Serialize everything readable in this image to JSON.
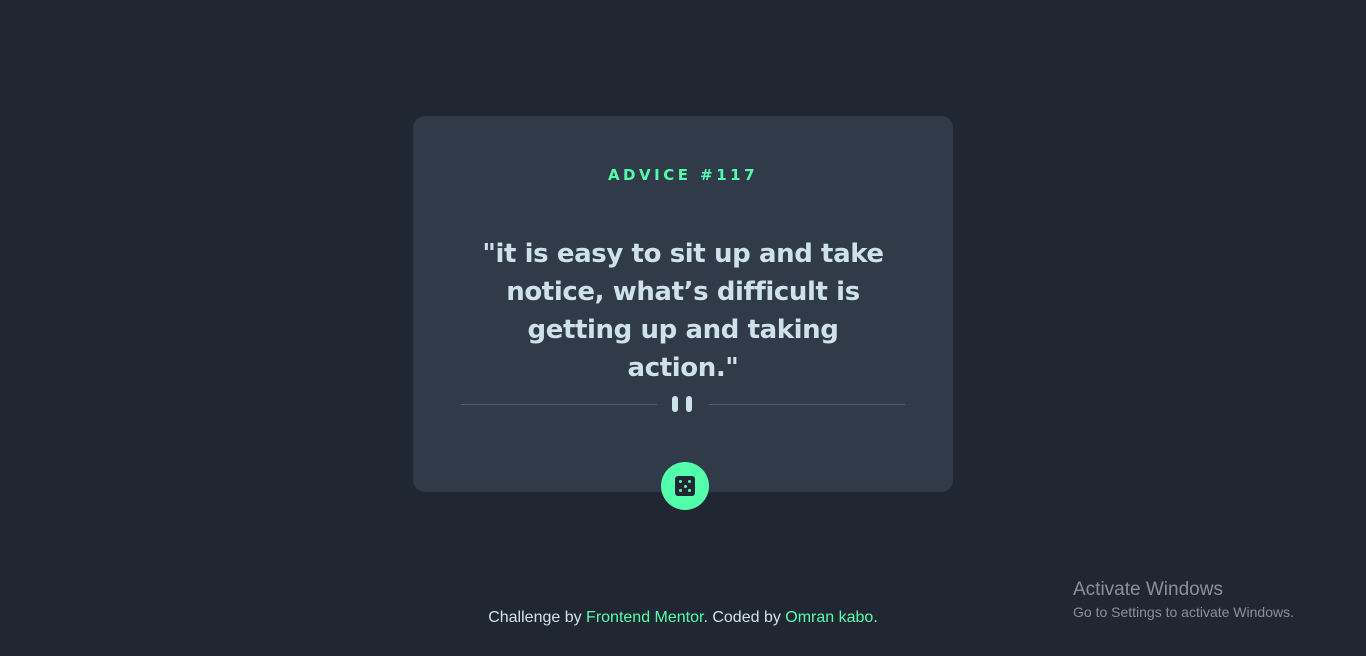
{
  "advice": {
    "heading": "ADVICE #117",
    "quote": "\"it is easy to sit up and take notice, what’s difficult is getting up and taking action.\""
  },
  "divider": {
    "icon": "pause-icon"
  },
  "actions": {
    "dice_icon": "dice-icon"
  },
  "footer": {
    "prefix": "Challenge by ",
    "challenge_link": "Frontend Mentor",
    "middle": ". Coded by ",
    "author_link": "Omran kabo",
    "suffix": "."
  },
  "watermark": {
    "title": "Activate Windows",
    "subtitle": "Go to Settings to activate Windows."
  },
  "colors": {
    "background": "#202733",
    "card": "#313a49",
    "accent": "#53ffaa",
    "text": "#cee3e9",
    "divider": "#4f5d74"
  }
}
